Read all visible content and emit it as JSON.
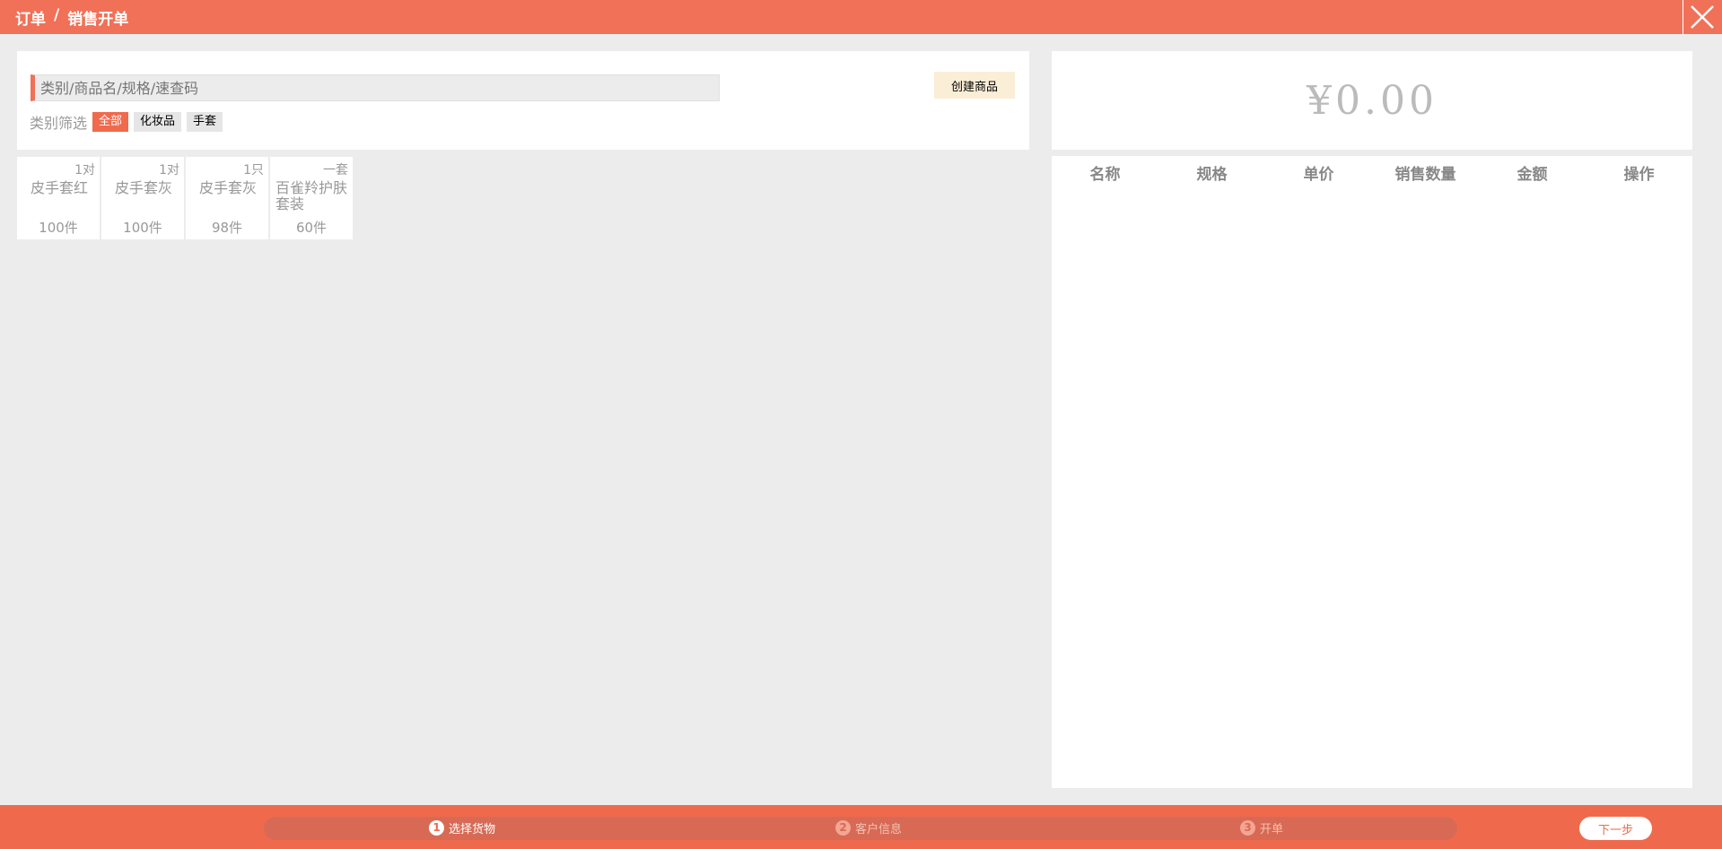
{
  "colors": {
    "accent": "#f07158",
    "bottom_bar": "#ef6a4c",
    "create_button_bg": "#fbeed6"
  },
  "header": {
    "breadcrumb": [
      "订单",
      "/",
      "销售开单"
    ],
    "close_icon": "close-icon"
  },
  "search": {
    "placeholder": "类别/商品名/规格/速查码",
    "value": ""
  },
  "create_button": {
    "label": "创建商品"
  },
  "filter": {
    "label": "类别筛选",
    "options": [
      {
        "label": "全部",
        "active": true
      },
      {
        "label": "化妆品",
        "active": false
      },
      {
        "label": "手套",
        "active": false
      }
    ]
  },
  "products": [
    {
      "unit": "1对",
      "name": "皮手套红",
      "stock": "100件"
    },
    {
      "unit": "1对",
      "name": "皮手套灰",
      "stock": "100件"
    },
    {
      "unit": "1只",
      "name": "皮手套灰",
      "stock": "98件"
    },
    {
      "unit": "一套",
      "name": "百雀羚护肤套装",
      "stock": "60件"
    }
  ],
  "summary": {
    "total": "¥0.00"
  },
  "order_table": {
    "columns": [
      "名称",
      "规格",
      "单价",
      "销售数量",
      "金额",
      "操作"
    ],
    "rows": []
  },
  "steps": [
    {
      "number": "1",
      "label": "选择货物",
      "active": true
    },
    {
      "number": "2",
      "label": "客户信息",
      "active": false
    },
    {
      "number": "3",
      "label": "开单",
      "active": false
    }
  ],
  "next_button": {
    "label": "下一步"
  }
}
